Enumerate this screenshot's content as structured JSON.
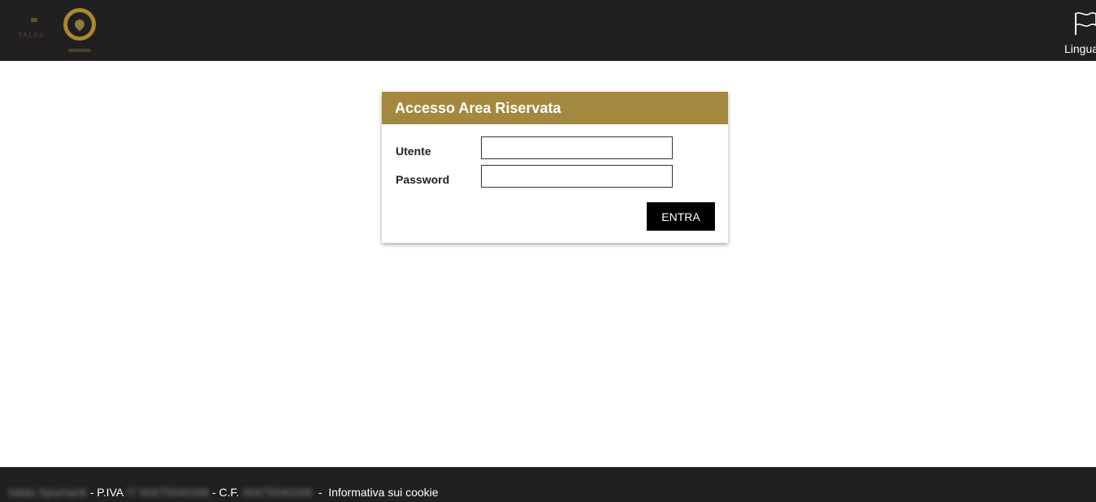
{
  "header": {
    "logo_text": "TALÈS",
    "language_label": "Lingua",
    "language_icon": "flag-icon"
  },
  "login": {
    "title": "Accesso Area Riservata",
    "user_label": "Utente",
    "password_label": "Password",
    "user_value": "",
    "password_value": "",
    "submit_label": "ENTRA"
  },
  "footer": {
    "company": "Valdo Spumanti",
    "piva_label": "- P.IVA",
    "piva_value": "IT 00475540268",
    "cf_label": "- C.F.",
    "cf_value": "00475540268",
    "separator": "-",
    "cookie_link": "Informativa sui cookie"
  },
  "colors": {
    "header_bg": "#211f20",
    "accent_gold": "#a4883f",
    "button_bg": "#000000"
  }
}
